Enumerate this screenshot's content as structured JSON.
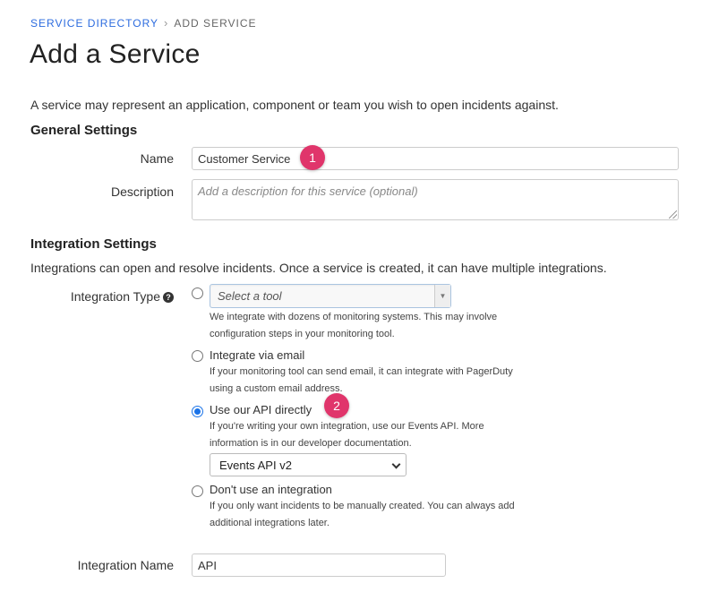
{
  "breadcrumb": {
    "parent": "SERVICE DIRECTORY",
    "separator_icon": "chevron-right-icon",
    "current": "ADD SERVICE"
  },
  "page": {
    "title": "Add a Service",
    "intro": "A service may represent an application, component or team you wish to open incidents against."
  },
  "general": {
    "heading": "General Settings",
    "name_label": "Name",
    "name_value": "Customer Service",
    "description_label": "Description",
    "description_placeholder": "Add a description for this service (optional)"
  },
  "integration": {
    "heading": "Integration Settings",
    "intro": "Integrations can open and resolve incidents. Once a service is created, it can have multiple integrations.",
    "type_label": "Integration Type",
    "help_icon": "question-circle-icon",
    "tool_select_placeholder": "Select a tool",
    "tool_help": "We integrate with dozens of monitoring systems. This may involve configuration steps in your monitoring tool.",
    "email_title": "Integrate via email",
    "email_help": "If your monitoring tool can send email, it can integrate with PagerDuty using a custom email address.",
    "api_title": "Use our API directly",
    "api_help": "If you're writing your own integration, use our Events API. More information is in our developer documentation.",
    "api_version": "Events API v2",
    "none_title": "Don't use an integration",
    "none_help": "If you only want incidents to be manually created. You can always add additional integrations later.",
    "selected": "api",
    "name_label": "Integration Name",
    "name_value": "API"
  },
  "annotations": {
    "badge1": "1",
    "badge2": "2",
    "badge_color": "#e0356b"
  },
  "colors": {
    "link": "#2d6cdf",
    "radio_selected": "#1a73e8"
  }
}
